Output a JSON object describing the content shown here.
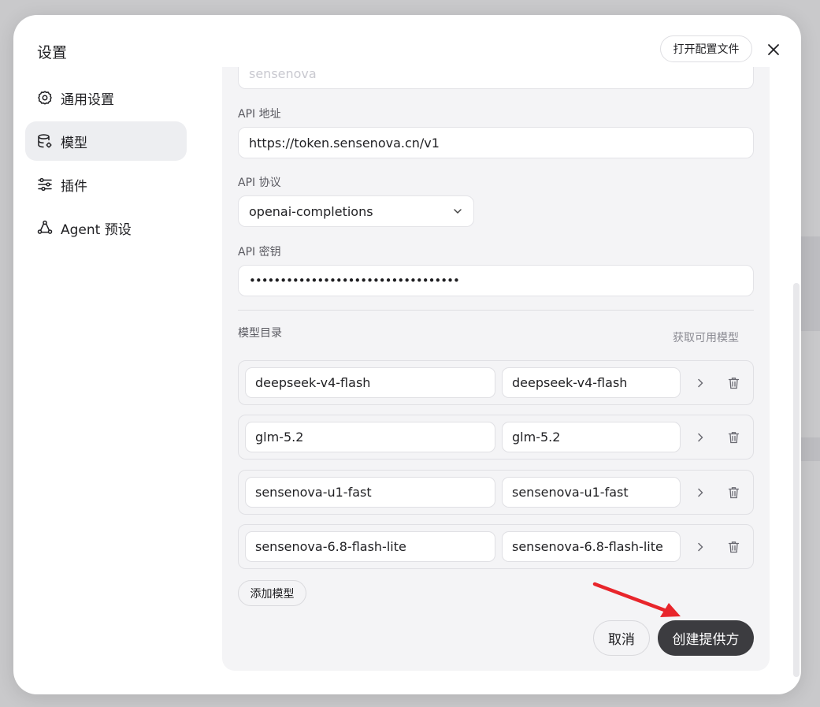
{
  "modal": {
    "title": "设置",
    "open_config_label": "打开配置文件"
  },
  "sidebar": {
    "items": [
      {
        "label": "通用设置",
        "icon": "gear-icon",
        "active": false
      },
      {
        "label": "模型",
        "icon": "database-gear-icon",
        "active": true
      },
      {
        "label": "插件",
        "icon": "sliders-icon",
        "active": false
      },
      {
        "label": "Agent 预设",
        "icon": "agent-nodes-icon",
        "active": false
      }
    ]
  },
  "provider": {
    "name_value": "sensenova",
    "api_address_label": "API 地址",
    "api_address_value": "https://token.sensenova.cn/v1",
    "api_protocol_label": "API 协议",
    "api_protocol_value": "openai-completions",
    "api_key_label": "API 密钥",
    "api_key_masked": "••••••••••••••••••••••••••••••••••"
  },
  "catalog": {
    "title": "模型目录",
    "fetch_label": "获取可用模型",
    "models": [
      {
        "id": "deepseek-v4-flash",
        "name": "deepseek-v4-flash"
      },
      {
        "id": "glm-5.2",
        "name": "glm-5.2"
      },
      {
        "id": "sensenova-u1-fast",
        "name": "sensenova-u1-fast"
      },
      {
        "id": "sensenova-6.8-flash-lite",
        "name": "sensenova-6.8-flash-lite"
      }
    ],
    "add_model_label": "添加模型"
  },
  "footer": {
    "cancel_label": "取消",
    "create_label": "创建提供方"
  },
  "colors": {
    "accent_dark": "#3c3c40",
    "arrow_red": "#e8252b",
    "panel_bg": "#f4f4f6"
  }
}
